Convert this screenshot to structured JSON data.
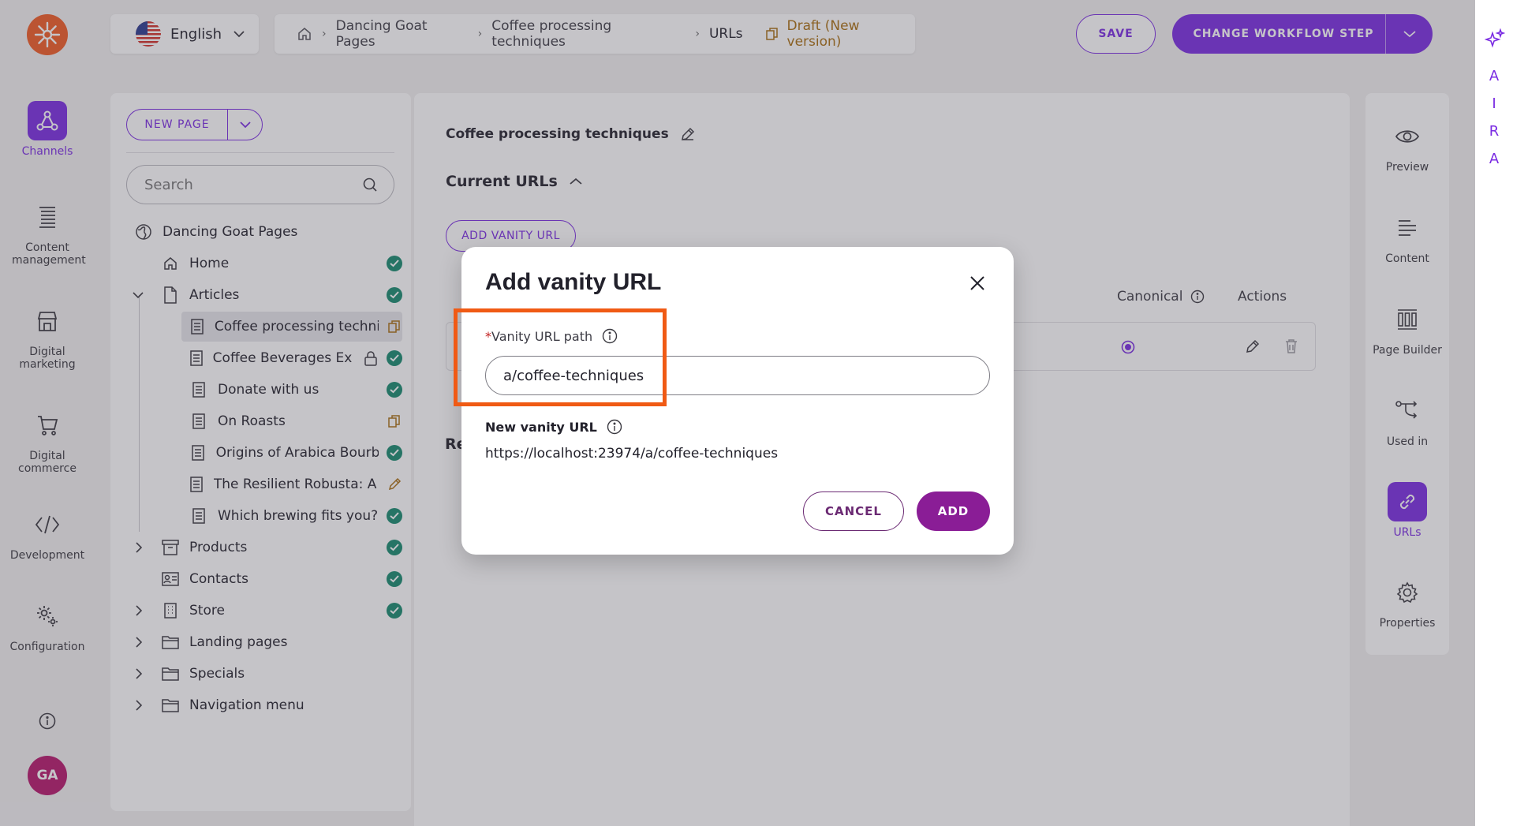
{
  "colors": {
    "accent": "#7a2be2",
    "brand": "#f05a22",
    "success": "#158a6d",
    "draft": "#a86d0f",
    "highlight": "#f05a14",
    "add_button": "#8a1d96"
  },
  "leftnav": {
    "items": [
      {
        "label": "Channels",
        "icon": "channels-icon",
        "active": true
      },
      {
        "label": "Content management",
        "icon": "content-management-icon"
      },
      {
        "label": "Digital marketing",
        "icon": "digital-marketing-icon"
      },
      {
        "label": "Digital commerce",
        "icon": "cart-icon"
      },
      {
        "label": "Development",
        "icon": "code-icon"
      },
      {
        "label": "Configuration",
        "icon": "gears-icon"
      }
    ],
    "avatar": "GA"
  },
  "header": {
    "language": "English",
    "breadcrumb": [
      "Dancing Goat Pages",
      "Coffee processing techniques",
      "URLs"
    ],
    "draft_status": "Draft (New version)",
    "save_label": "SAVE",
    "workflow_label": "CHANGE WORKFLOW STEP"
  },
  "aira": {
    "letters": [
      "A",
      "I",
      "R",
      "A"
    ]
  },
  "tree": {
    "new_page_label": "NEW PAGE",
    "search_placeholder": "Search",
    "root": "Dancing Goat Pages",
    "nodes": [
      {
        "label": "Home",
        "status": "published"
      },
      {
        "label": "Articles",
        "status": "published"
      },
      {
        "label": "Coffee processing techniques",
        "status": "draft"
      },
      {
        "label": "Coffee Beverages Explained",
        "status": "published-locked"
      },
      {
        "label": "Donate with us",
        "status": "published"
      },
      {
        "label": "On Roasts",
        "status": "draft"
      },
      {
        "label": "Origins of Arabica Bourbon",
        "status": "published"
      },
      {
        "label": "The Resilient Robusta: A Coffee",
        "status": "edit"
      },
      {
        "label": "Which brewing fits you?",
        "status": "published"
      },
      {
        "label": "Products",
        "status": "published"
      },
      {
        "label": "Contacts",
        "status": "published"
      },
      {
        "label": "Store",
        "status": "published"
      },
      {
        "label": "Landing pages",
        "status": ""
      },
      {
        "label": "Specials",
        "status": ""
      },
      {
        "label": "Navigation menu",
        "status": ""
      }
    ]
  },
  "main": {
    "page_title": "Coffee processing techniques",
    "current_urls": "Current URLs",
    "add_vanity_label": "ADD VANITY URL",
    "col_canonical": "Canonical",
    "col_actions": "Actions",
    "section_re": "Re"
  },
  "rightpanel": {
    "items": [
      {
        "label": "Preview",
        "icon": "eye-icon"
      },
      {
        "label": "Content",
        "icon": "content-icon"
      },
      {
        "label": "Page Builder",
        "icon": "page-builder-icon"
      },
      {
        "label": "Used in",
        "icon": "used-in-icon"
      },
      {
        "label": "URLs",
        "icon": "link-icon",
        "active": true
      },
      {
        "label": "Properties",
        "icon": "gear-icon"
      }
    ]
  },
  "modal": {
    "title": "Add vanity URL",
    "required_mark": "*",
    "path_label": "Vanity URL path",
    "path_value": "a/coffee-techniques",
    "new_url_label": "New vanity URL",
    "new_url_value": "https://localhost:23974/a/coffee-techniques",
    "cancel_label": "CANCEL",
    "add_label": "ADD"
  }
}
